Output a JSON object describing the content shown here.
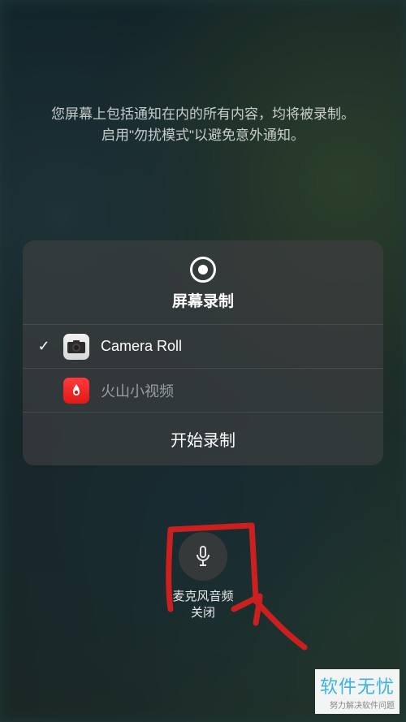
{
  "banner": {
    "line1": "您屏幕上包括通知在内的所有内容，均将被录制。",
    "line2": "启用\"勿扰模式\"以避免意外通知。"
  },
  "panel": {
    "title": "屏幕录制",
    "options": [
      {
        "label": "Camera Roll",
        "selected": true,
        "icon": "camera"
      },
      {
        "label": "火山小视频",
        "selected": false,
        "icon": "huoshan"
      }
    ],
    "start_label": "开始录制"
  },
  "mic": {
    "label": "麦克风音频",
    "state": "关闭"
  },
  "watermark": {
    "text": "软件无忧",
    "subtitle": "努力解决软件问题"
  },
  "colors": {
    "accent_red": "#e01818",
    "panel_bg": "rgba(60,62,64,0.72)",
    "annotation": "#cc2020"
  }
}
